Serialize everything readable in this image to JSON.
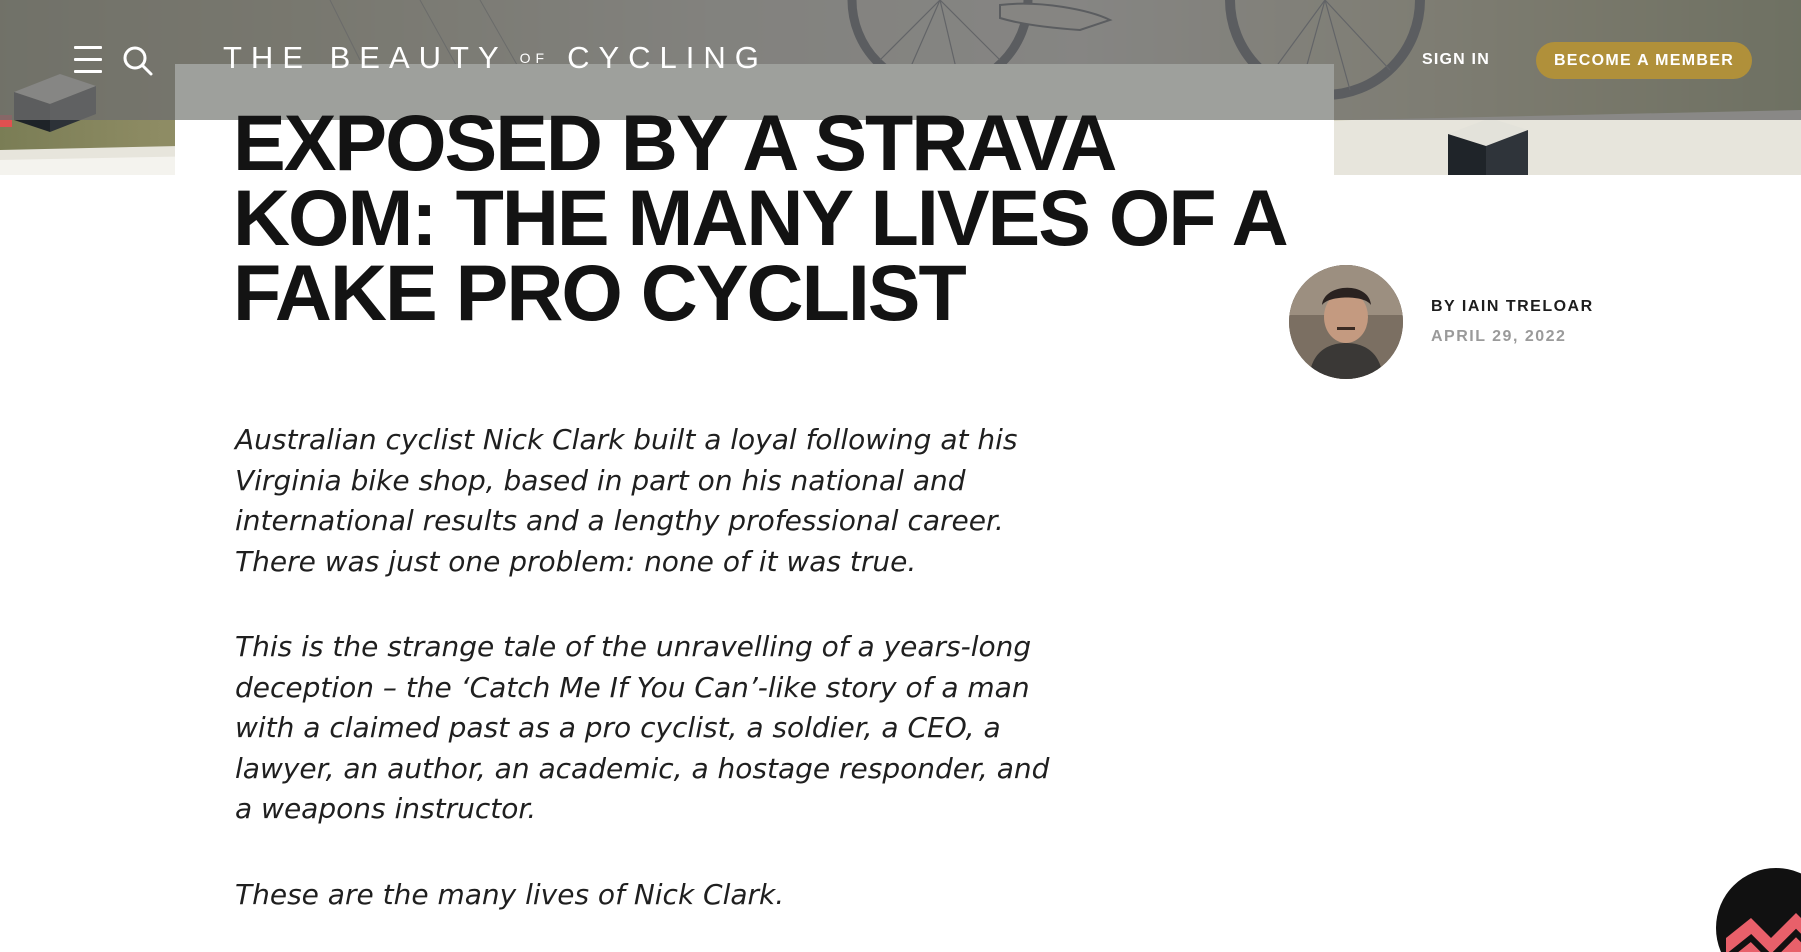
{
  "site": {
    "logo_left": "THE BEAUTY",
    "logo_of": "OF",
    "logo_right": "CYCLING"
  },
  "header": {
    "sign_in": "SIGN IN",
    "become_member": "BECOME A MEMBER"
  },
  "article": {
    "title": "EXPOSED BY A STRAVA KOM: THE MANY LIVES OF A FAKE PRO CYCLIST",
    "byline": "BY IAIN TRELOAR",
    "date": "APRIL 29, 2022",
    "paragraphs": [
      "Australian cyclist Nick Clark built a loyal following at his Virginia bike shop, based in part on his national and international results and a lengthy professional career. There was just one problem: none of it was true.",
      "This is the strange tale of the unravelling of a years-long deception – the ‘Catch Me If You Can’-like story of a man with a claimed past as a pro cyclist, a soldier, a CEO, a lawyer, an author, an academic, a hostage responder, and a weapons instructor.",
      "These are the many lives of Nick Clark."
    ]
  },
  "icons": {
    "menu": "hamburger-menu-icon",
    "search": "search-icon"
  },
  "colors": {
    "accent": "#b0903a",
    "headline": "#131313",
    "date": "#9a9a9a"
  }
}
